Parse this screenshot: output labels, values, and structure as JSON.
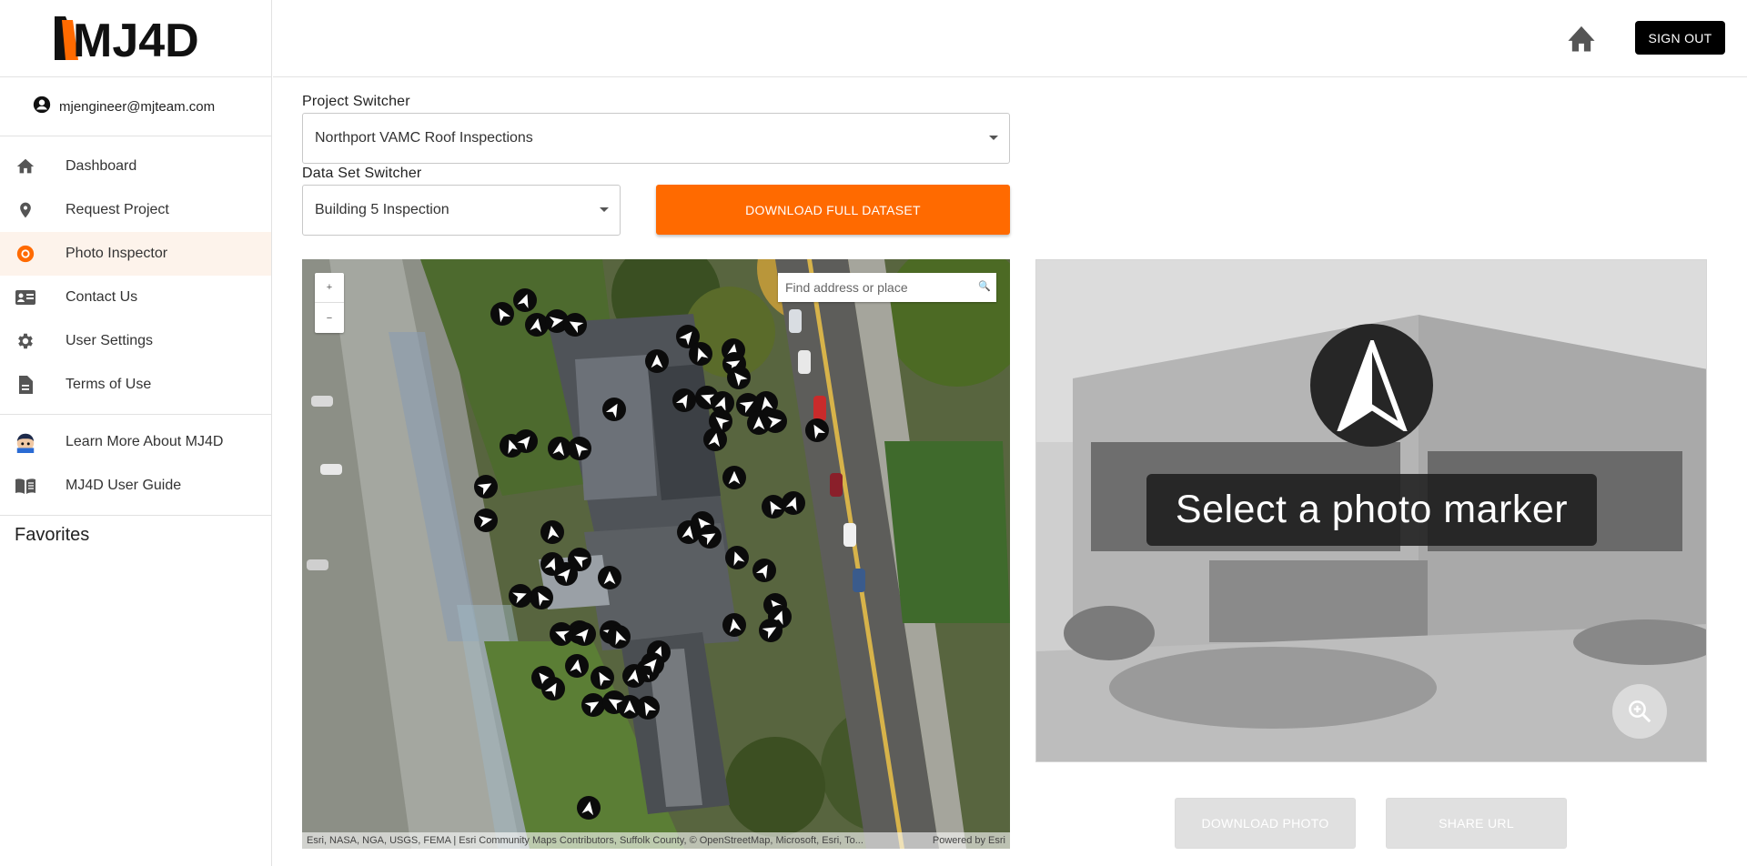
{
  "app": {
    "logo": "MJ4D"
  },
  "user": {
    "email": "mjengineer@mjteam.com"
  },
  "nav": {
    "items": [
      {
        "label": "Dashboard",
        "icon": "home-icon"
      },
      {
        "label": "Request Project",
        "icon": "location-pin-icon"
      },
      {
        "label": "Photo Inspector",
        "icon": "camera-icon",
        "active": true
      },
      {
        "label": "Contact Us",
        "icon": "contact-card-icon"
      },
      {
        "label": "User Settings",
        "icon": "gear-icon"
      },
      {
        "label": "Terms of Use",
        "icon": "document-icon"
      }
    ],
    "secondary": [
      {
        "label": "Learn More About MJ4D",
        "icon": "mascot-icon"
      },
      {
        "label": "MJ4D User Guide",
        "icon": "book-icon"
      }
    ],
    "favorites_label": "Favorites"
  },
  "header": {
    "signout_label": "SIGN OUT"
  },
  "project_switcher": {
    "label": "Project Switcher",
    "value": "Northport VAMC Roof Inspections"
  },
  "dataset_switcher": {
    "label": "Data Set Switcher",
    "value": "Building 5 Inspection"
  },
  "download_full_label": "DOWNLOAD FULL DATASET",
  "map": {
    "search_placeholder": "Find address or place",
    "attribution": "Esri, NASA, NGA, USGS, FEMA | Esri Community Maps Contributors, Suffolk County, © OpenStreetMap, Microsoft, Esri, To...",
    "powered_by": "Powered by Esri"
  },
  "viewer": {
    "prompt": "Select a photo marker"
  },
  "actions": {
    "download_photo": "DOWNLOAD PHOTO",
    "share_url": "SHARE URL"
  },
  "colors": {
    "accent": "#ff6a00",
    "active_bg": "#fdf3eb"
  }
}
